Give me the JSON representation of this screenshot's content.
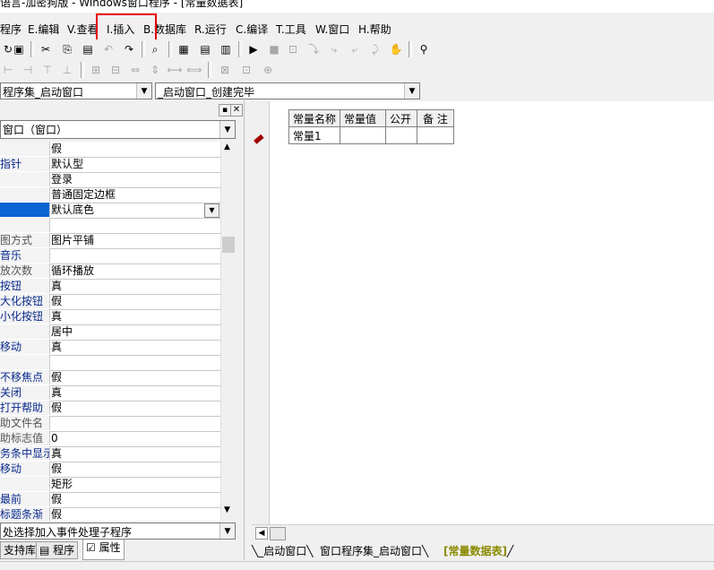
{
  "title": "语言-加密狗版 - Windows窗口程序 - [常量数据表]",
  "menu": [
    "程序",
    "E.编辑",
    "V.查看",
    "I.插入",
    "B.数据库",
    "R.运行",
    "C.编译",
    "T.工具",
    "W.窗口",
    "H.帮助"
  ],
  "toolbar": {
    "icons": [
      "open-icon",
      "save-icon",
      "cut-icon",
      "copy-icon",
      "paste-icon",
      "undo-icon",
      "redo-icon",
      "find-icon",
      "layout1-icon",
      "layout2-icon",
      "layout3-icon",
      "run-icon",
      "stop-icon",
      "step1-icon",
      "step2-icon",
      "step3-icon",
      "step4-icon",
      "step5-icon",
      "hand-icon",
      "binoculars-icon"
    ]
  },
  "combo1": "程序集_启动窗口",
  "combo2": "_启动窗口_创建完毕",
  "panel": {
    "object_combo": "窗口（窗口）",
    "properties": [
      {
        "k": "",
        "v": "假"
      },
      {
        "k": "指针",
        "v": "默认型"
      },
      {
        "k": "",
        "v": "登录"
      },
      {
        "k": "",
        "v": "普通固定边框"
      },
      {
        "k": "",
        "v": "默认底色"
      },
      {
        "k": "",
        "v": ""
      },
      {
        "k": "图方式",
        "v": "图片平铺"
      },
      {
        "k": "音乐",
        "v": ""
      },
      {
        "k": "放次数",
        "v": "循环播放"
      },
      {
        "k": "按钮",
        "v": "真"
      },
      {
        "k": "大化按钮",
        "v": "假"
      },
      {
        "k": "小化按钮",
        "v": "真"
      },
      {
        "k": "",
        "v": "居中"
      },
      {
        "k": "移动",
        "v": "真"
      },
      {
        "k": "",
        "v": ""
      },
      {
        "k": "不移焦点",
        "v": "假"
      },
      {
        "k": "关闭",
        "v": "真"
      },
      {
        "k": "打开帮助",
        "v": "假"
      },
      {
        "k": "助文件名",
        "v": ""
      },
      {
        "k": "助标志值",
        "v": "0"
      },
      {
        "k": "务条中显示",
        "v": "真"
      },
      {
        "k": "移动",
        "v": "假"
      },
      {
        "k": "",
        "v": "矩形"
      },
      {
        "k": "最前",
        "v": "假"
      },
      {
        "k": "标题条渐",
        "v": "假"
      }
    ],
    "event_combo": "处选择加入事件处理子程序",
    "tabs": [
      "支持库",
      "程序",
      "属性"
    ]
  },
  "const_table": {
    "headers": [
      "常量名称",
      "常量值",
      "公开",
      "备 注"
    ],
    "rows": [
      [
        "常量1",
        "",
        "",
        ""
      ]
    ]
  },
  "doc_tabs": [
    "_启动窗口",
    "窗口程序集_启动窗口",
    "[常量数据表]"
  ],
  "colors": {
    "highlight_box": "#e60000",
    "selected_row": "#0a64d2",
    "active_tab_text": "#8a8a00"
  }
}
